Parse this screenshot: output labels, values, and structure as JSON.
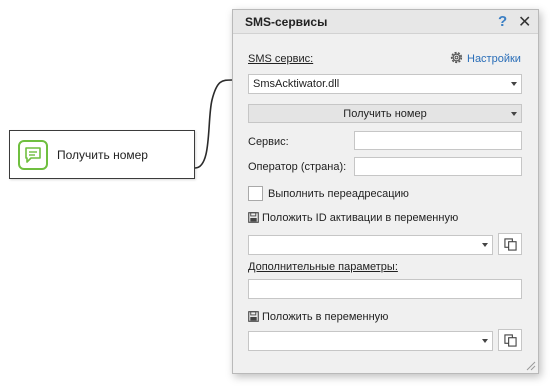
{
  "node": {
    "label": "Получить номер"
  },
  "dialog": {
    "title": "SMS-сервисы",
    "help": "?",
    "close": "✕",
    "settings_label": "Настройки",
    "sms_service_label": "SMS сервис:",
    "sms_service_value": "SmsAcktiwator.dll",
    "action_value": "Получить номер",
    "service_label": "Сервис:",
    "service_value": "",
    "operator_label": "Оператор (страна):",
    "operator_value": "",
    "redirect_label": "Выполнить переадресацию",
    "redirect_checked": false,
    "activation_id_label": "Положить ID активации в переменную",
    "activation_id_value": "",
    "extra_params_label": "Дополнительные параметры:",
    "extra_params_value": "",
    "put_var_label": "Положить в переменную",
    "put_var_value": ""
  },
  "colors": {
    "node_icon_accent": "#6fbf3f",
    "help_accent": "#3b7fc4",
    "link": "#2a6eb8"
  },
  "icons": {
    "node": "chat-bubble-icon",
    "settings": "gear-icon",
    "save": "floppy-disk-icon",
    "copy": "copy-icon",
    "resize": "resize-grip-icon"
  }
}
